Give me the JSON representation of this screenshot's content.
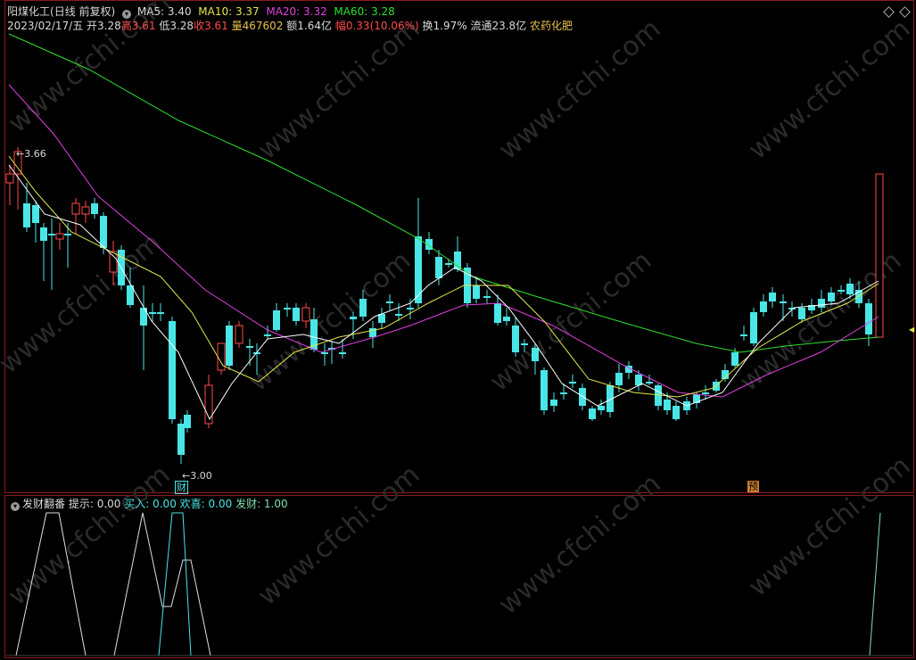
{
  "header": {
    "stock_name": "阳煤化工",
    "period": "(日线 前复权)",
    "ma5": "MA5: 3.40",
    "ma10": "MA10: 3.37",
    "ma20": "MA20: 3.32",
    "ma60": "MA60: 3.28"
  },
  "quote": {
    "date": "2023/02/17/五",
    "open": "开3.28",
    "high": "高3.61",
    "low": "低3.28",
    "close": "收3.61",
    "volume": "量467602",
    "amount": "额1.64亿",
    "change": "幅0.33(10.06%)",
    "turnover": "换1.97%",
    "float": "流通23.8亿",
    "sector": "农药化肥"
  },
  "annotations": {
    "high_price": "3.66",
    "low_price": "3.00",
    "marker_cai": "财",
    "marker_yu": "预"
  },
  "indicator": {
    "name": "发财翻番",
    "hint": "提示: 0.00",
    "buy": "买入: 0.00",
    "joy": "欢喜: 0.00",
    "fortune": "发财: 1.00"
  },
  "watermark": "www.cfchi.com",
  "colors": {
    "up": "#ff4a4a",
    "down": "#4ae6e6",
    "ma5": "#ffffff",
    "ma10": "#e6e64a",
    "ma20": "#e040e0",
    "ma60": "#2ee02e",
    "border": "#8b1c1c"
  }
}
